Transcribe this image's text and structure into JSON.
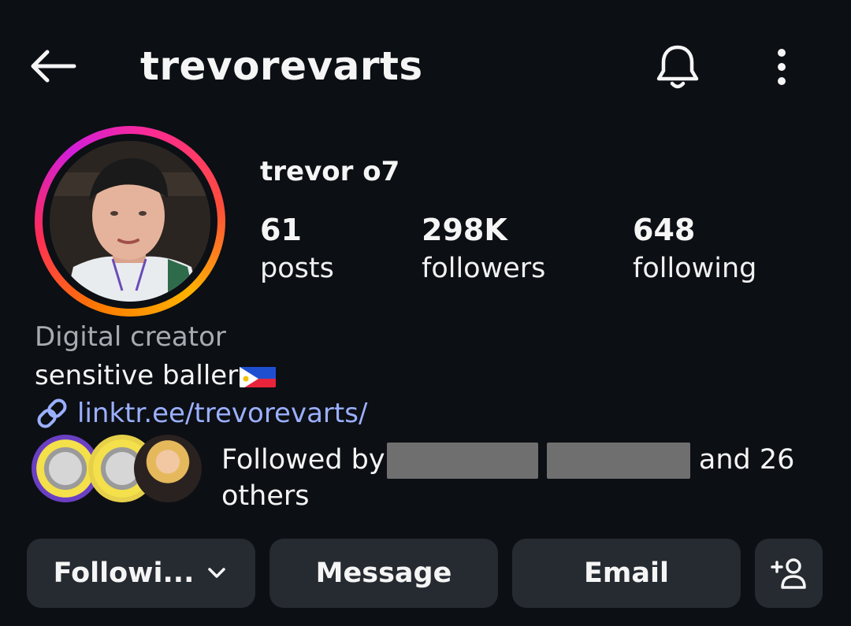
{
  "header": {
    "username": "trevorevarts",
    "back_icon": "arrow-left-icon",
    "notifications_icon": "bell-icon",
    "more_icon": "more-vertical-icon"
  },
  "profile": {
    "full_name": "trevor o7",
    "stats": [
      {
        "value": "61",
        "label": "posts"
      },
      {
        "value": "298K",
        "label": "followers"
      },
      {
        "value": "648",
        "label": "following"
      }
    ],
    "category": "Digital creator",
    "bio": "sensitive baller",
    "bio_emoji": "philippines-flag",
    "link": "linktr.ee/trevorevarts/",
    "link_icon": "link-icon"
  },
  "followed_by": {
    "prefix": "Followed by",
    "suffix": "and 26",
    "line2": "others"
  },
  "buttons": {
    "following": "Followi...",
    "following_icon": "chevron-down-icon",
    "message": "Message",
    "email": "Email",
    "add_user_icon": "add-person-icon"
  },
  "colors": {
    "background": "#0c0f14",
    "button_bg": "#262a31",
    "link": "#9bb0ff",
    "muted_text": "#a8abb2"
  }
}
